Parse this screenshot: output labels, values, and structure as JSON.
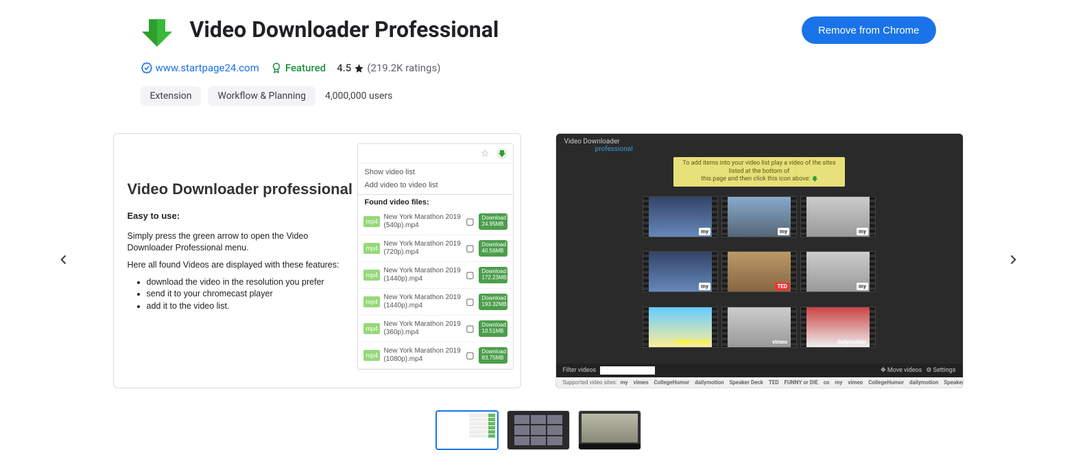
{
  "header": {
    "title": "Video Downloader Professional",
    "remove_btn": "Remove from Chrome"
  },
  "meta": {
    "site": "www.startpage24.com",
    "featured": "Featured",
    "rating_value": "4.5",
    "rating_count": "(219.2K ratings)"
  },
  "chips": {
    "extension": "Extension",
    "category": "Workflow & Planning",
    "users": "4,000,000 users"
  },
  "slide1": {
    "title": "Video Downloader professional",
    "easy": "Easy to use:",
    "desc1": "Simply press the green arrow to open the Video Downloader Professional menu.",
    "desc2": "Here all found Videos are displayed with these features:",
    "b1": "download the video in the resolution you prefer",
    "b2": "send it to your chromecast player",
    "b3": "add it to the video list.",
    "menu_show": "Show video list",
    "menu_add": "Add video to video list",
    "found": "Found video files:",
    "fmt": "mp4",
    "dl_label": "Download",
    "rows": [
      {
        "t": "New York Marathon 2019 (540p).mp4",
        "s": "24.95MB"
      },
      {
        "t": "New York Marathon 2019 (720p).mp4",
        "s": "40.56MB"
      },
      {
        "t": "New York Marathon 2019 (1440p).mp4",
        "s": "172.23MB"
      },
      {
        "t": "New York Marathon 2019 (1440p).mp4",
        "s": "193.32MB"
      },
      {
        "t": "New York Marathon 2019 (360p).mp4",
        "s": "10.51MB"
      },
      {
        "t": "New York Marathon 2019 (1080p).mp4",
        "s": "83.75MB"
      }
    ]
  },
  "slide2": {
    "title": "Video Downloader",
    "pro": "professional",
    "banner_1": "To add items into your video list play a video of the sites listed at the bottom of",
    "banner_2": "this page and then click this icon above:",
    "filter_label": "Filter videos",
    "move": "Move videos",
    "settings": "Settings",
    "sup": "Supported video sites:",
    "brands": [
      "my",
      "vimeo",
      "CollegeHumor",
      "dailymotion",
      "Speaker Deck",
      "TED",
      "FUNNY or DIE",
      "co",
      "my",
      "vimeo",
      "CollegeHumor",
      "dailymotion",
      "Speaker Deck"
    ],
    "thumb_labels": [
      "my",
      "my",
      "my",
      "my",
      "TED",
      "my",
      "FUNNY or DIE",
      "vimeo",
      "dailymotion"
    ]
  }
}
